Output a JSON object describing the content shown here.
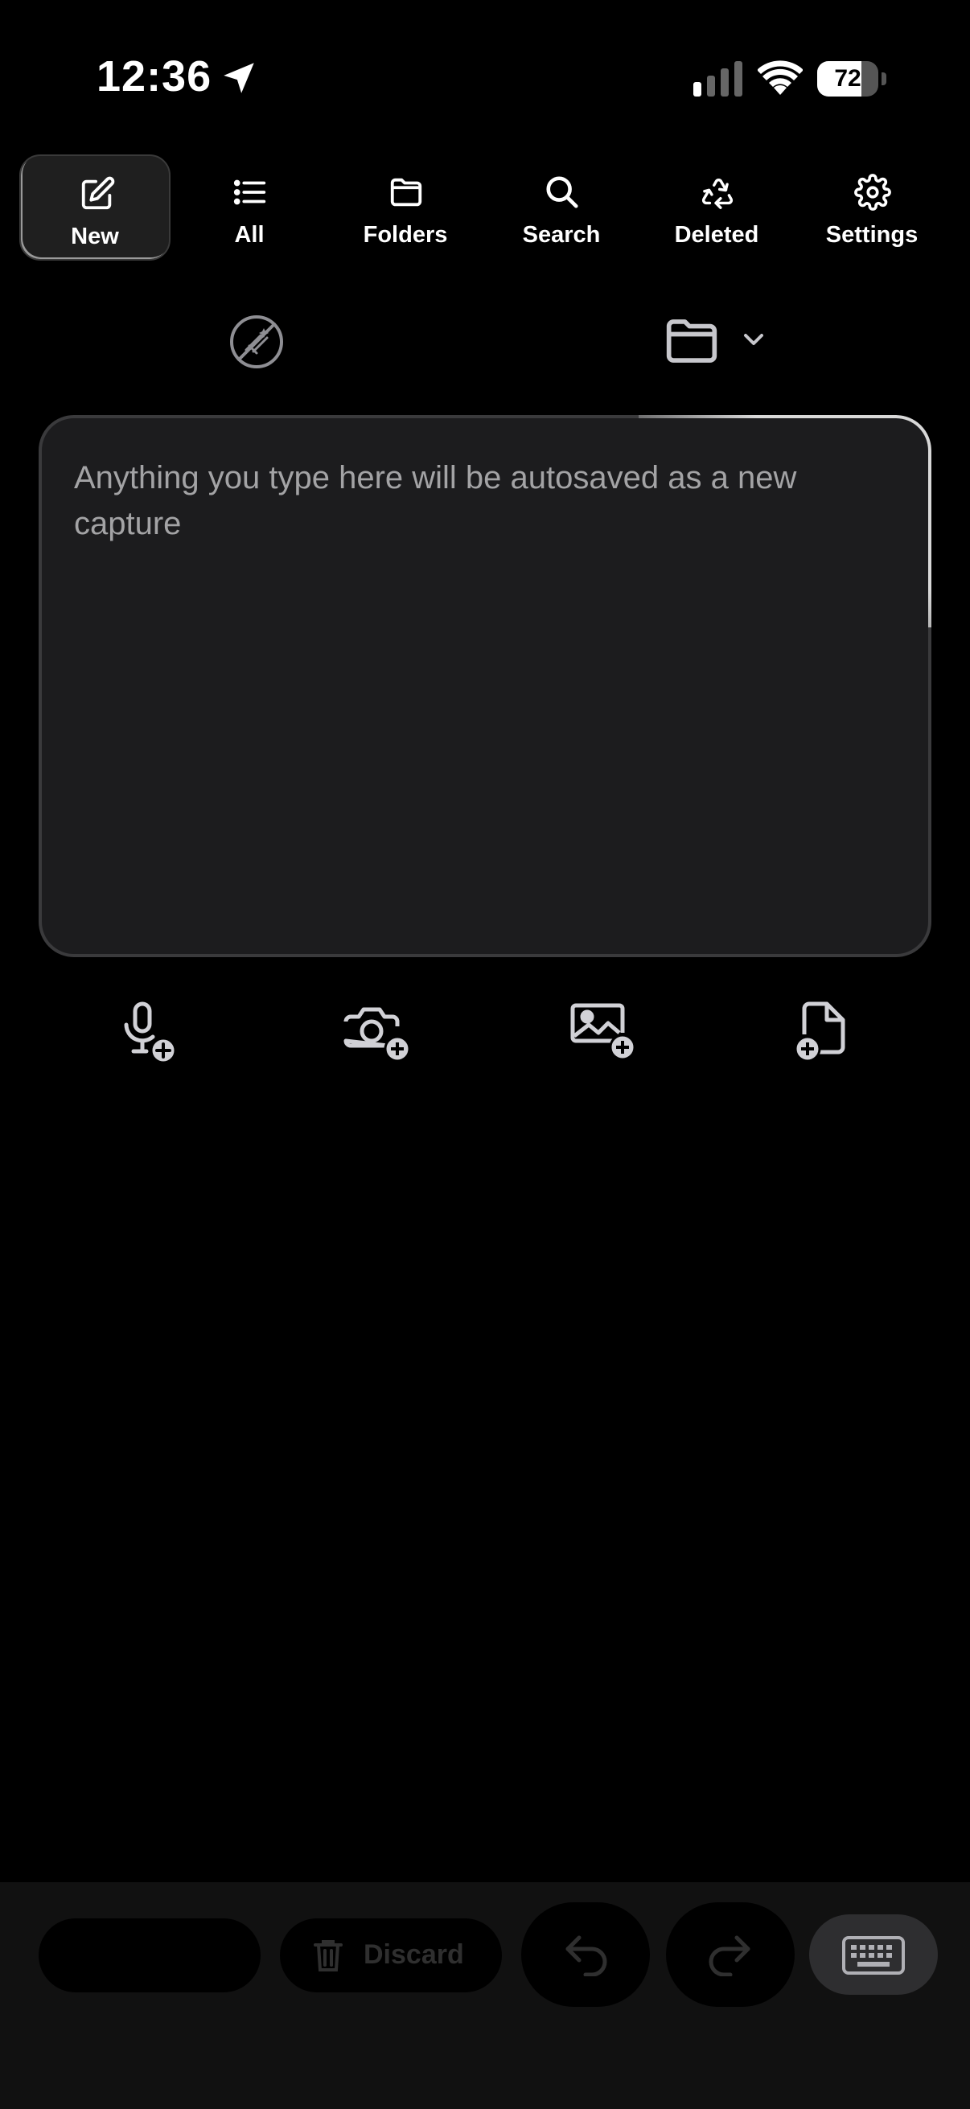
{
  "status": {
    "time": "12:36",
    "battery": "72",
    "battery_level": 0.72
  },
  "nav": {
    "items": [
      {
        "label": "New",
        "icon": "compose-icon",
        "active": true
      },
      {
        "label": "All",
        "icon": "list-icon"
      },
      {
        "label": "Folders",
        "icon": "folder-icon"
      },
      {
        "label": "Search",
        "icon": "search-icon"
      },
      {
        "label": "Deleted",
        "icon": "recycle-icon"
      },
      {
        "label": "Settings",
        "icon": "gear-icon"
      }
    ]
  },
  "toolbar": {
    "ai_icon": "ai-disabled-icon",
    "folder_icon": "folder-picker-icon"
  },
  "capture": {
    "placeholder": "Anything you type here will be autosaved as a new capture",
    "value": ""
  },
  "attach": [
    {
      "icon": "add-audio-icon"
    },
    {
      "icon": "add-photo-camera-icon"
    },
    {
      "icon": "add-image-icon"
    },
    {
      "icon": "add-file-icon"
    }
  ],
  "bottom": {
    "discard_label": "Discard"
  },
  "colors": {
    "background": "#000000",
    "panel": "#1c1c1e",
    "border": "#3a3a3c",
    "placeholder": "#a3a3a5"
  }
}
